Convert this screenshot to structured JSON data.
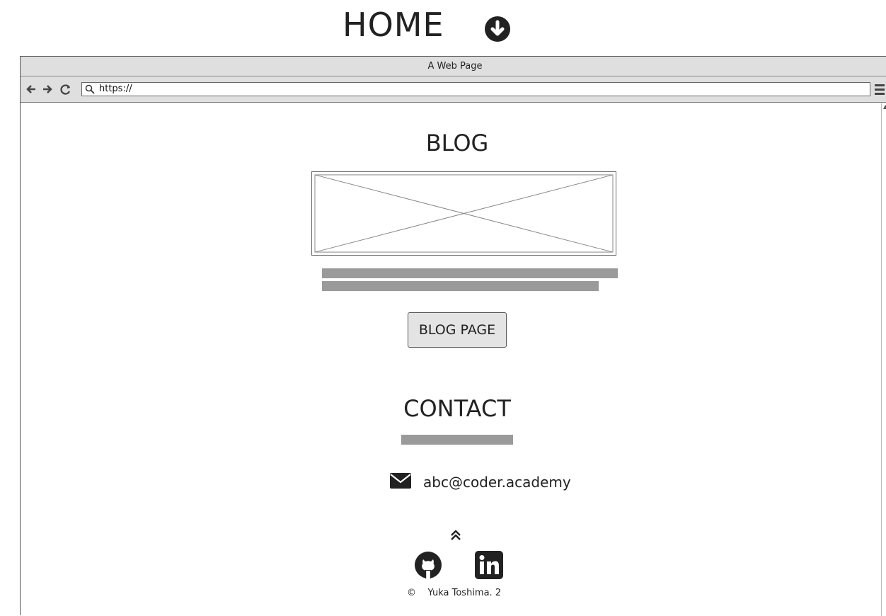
{
  "heading": {
    "title": "HOME"
  },
  "browser": {
    "window_title": "A Web Page",
    "url": "https://"
  },
  "blog": {
    "title": "BLOG",
    "button_label": "BLOG PAGE"
  },
  "contact": {
    "title": "CONTACT",
    "email": "abc@coder.academy"
  },
  "footer": {
    "copyright_symbol": "©",
    "copyright_text": "Yuka Toshima. 2"
  },
  "icons": {
    "heading": "arrow-down-circle-icon",
    "nav": [
      "back-arrow-icon",
      "forward-arrow-icon",
      "reload-icon"
    ],
    "url": "search-icon",
    "menu": "hamburger-menu-icon",
    "contact": "envelope-icon",
    "footer": [
      "double-chevron-up-icon",
      "github-icon",
      "linkedin-icon"
    ]
  },
  "colors": {
    "chrome": "#dfdfdf",
    "placeholder_bar": "#9a9a9a",
    "button_bg": "#e4e4e4",
    "text": "#222222"
  }
}
